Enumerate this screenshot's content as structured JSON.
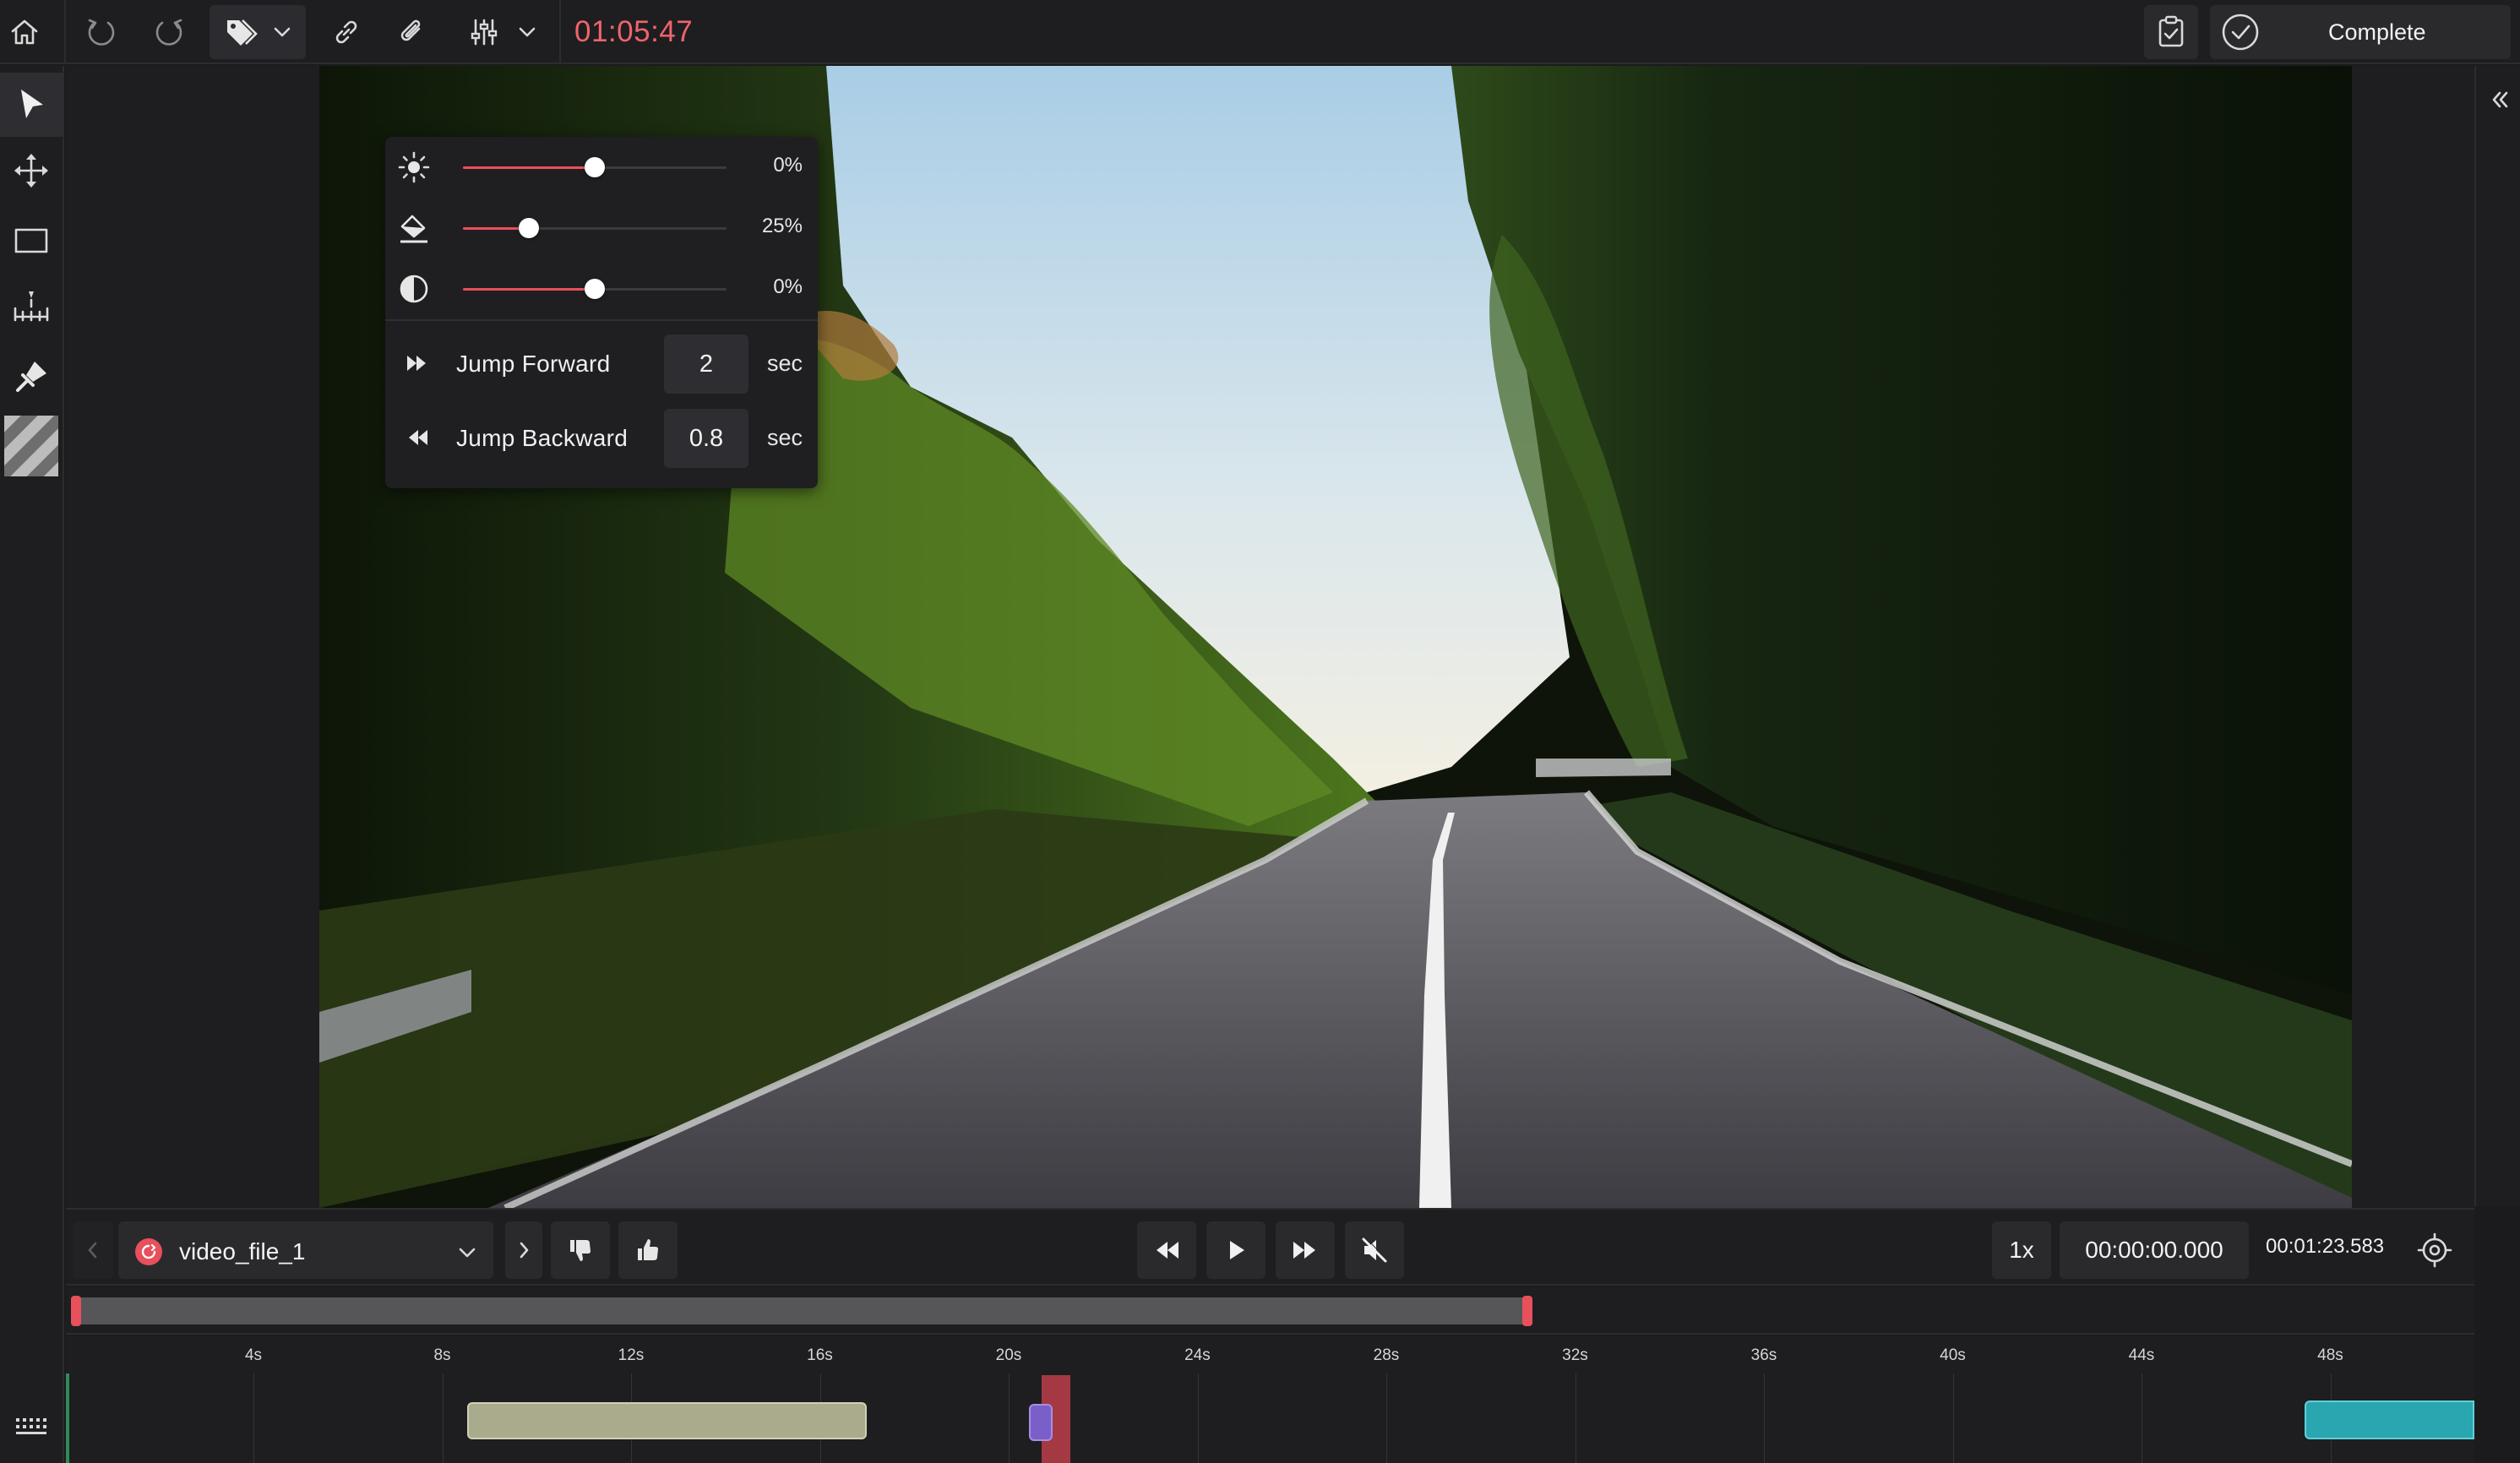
{
  "toolbar": {
    "timer": "01:05:47",
    "complete_label": "Complete"
  },
  "adjustments": {
    "brightness": {
      "icon": "sun-icon",
      "value": 0.5,
      "label": "0%"
    },
    "saturation": {
      "icon": "fill-icon",
      "value": 0.25,
      "label": "25%"
    },
    "contrast": {
      "icon": "contrast-icon",
      "value": 0.5,
      "label": "0%"
    }
  },
  "jump": {
    "forward": {
      "label": "Jump Forward",
      "value": "2",
      "unit": "sec"
    },
    "backward": {
      "label": "Jump Backward",
      "value": "0.8",
      "unit": "sec"
    }
  },
  "player": {
    "file_name": "video_file_1",
    "speed": "1x",
    "current_time": "00:00:00.000",
    "total_time": "00:01:23.583"
  },
  "timeline": {
    "ticks": [
      "4s",
      "8s",
      "12s",
      "16s",
      "20s",
      "24s",
      "28s",
      "32s",
      "36s",
      "40s",
      "44s",
      "48s"
    ]
  },
  "colors": {
    "accent": "#e8505b",
    "timer": "#f0646c",
    "segment_olive": "#a9ab8c",
    "segment_purple": "#7b5fc8",
    "segment_red": "#b33c48",
    "segment_teal": "#2aa6b0"
  }
}
